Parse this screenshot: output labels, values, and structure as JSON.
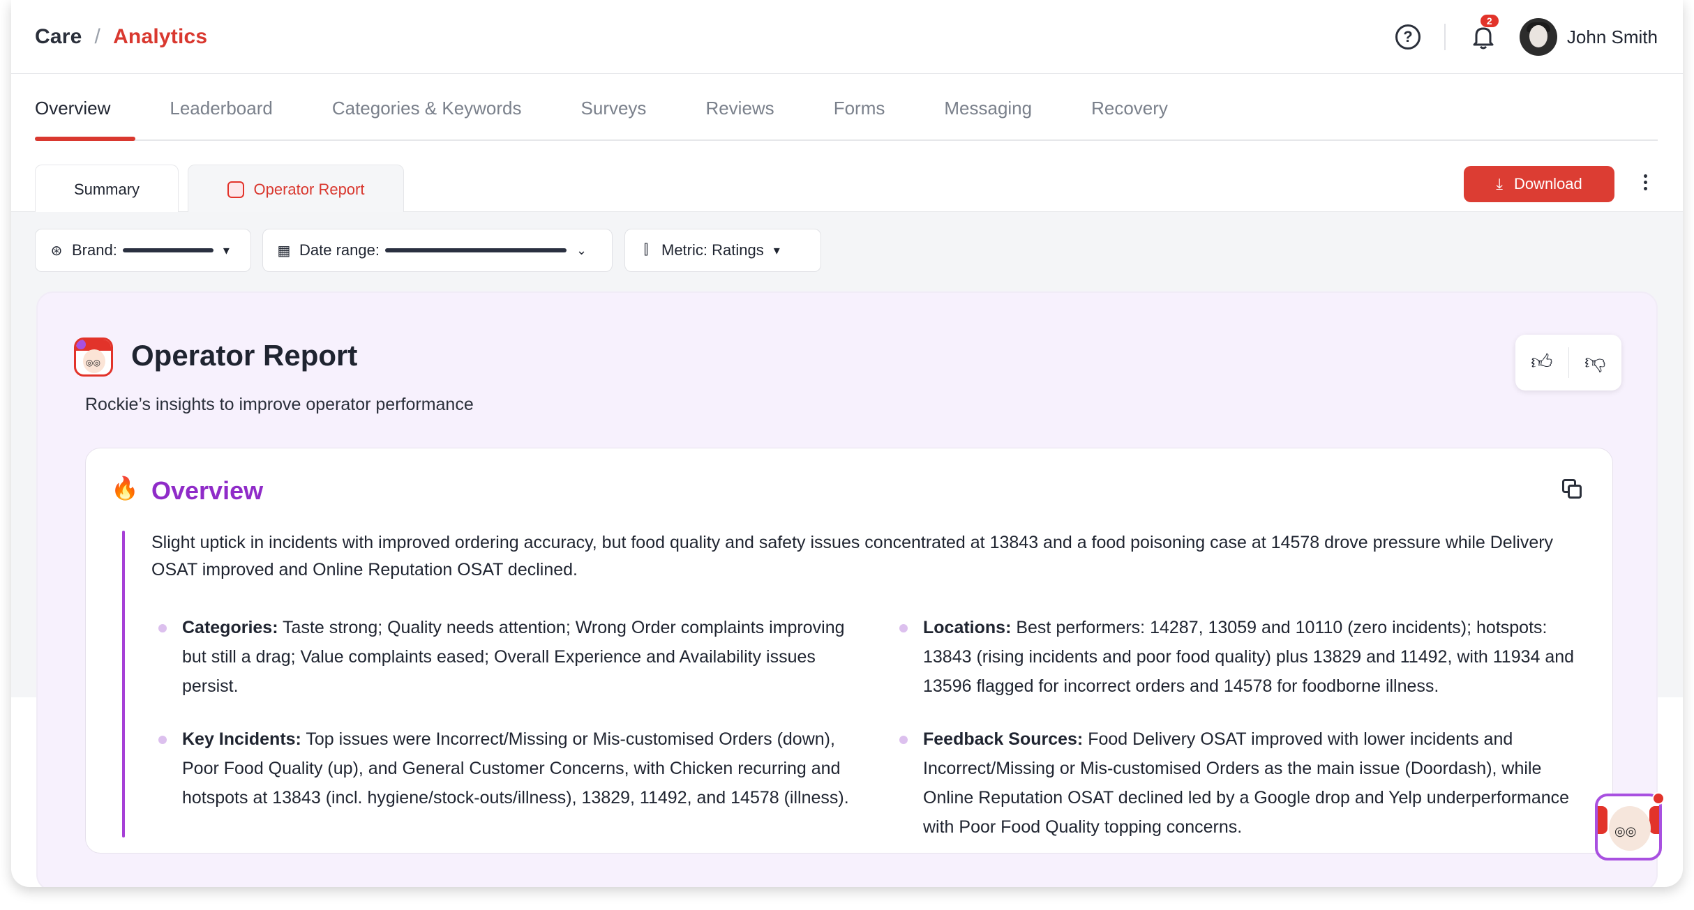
{
  "breadcrumb": {
    "parent": "Care",
    "separator": "/",
    "current": "Analytics"
  },
  "header": {
    "help_icon": "question-circle-icon",
    "notification_count": "2",
    "user_name": "John Smith"
  },
  "tabs": [
    {
      "label": "Overview",
      "active": true
    },
    {
      "label": "Leaderboard"
    },
    {
      "label": "Categories & Keywords"
    },
    {
      "label": "Surveys"
    },
    {
      "label": "Reviews"
    },
    {
      "label": "Forms"
    },
    {
      "label": "Messaging"
    },
    {
      "label": "Recovery"
    }
  ],
  "subtabs": {
    "summary": "Summary",
    "operator": "Operator Report"
  },
  "toolbar": {
    "download_label": "Download"
  },
  "filters": {
    "brand_label": "Brand:",
    "date_label": "Date range:",
    "metric_label": "Metric: Ratings"
  },
  "report": {
    "title": "Operator Report",
    "subtitle": "Rockie’s insights to improve operator performance",
    "overview_title": "Overview",
    "summary": "Slight uptick in incidents with improved ordering accuracy, but food quality and safety issues concentrated at 13843 and a food poisoning case at 14578 drove pressure while Delivery OSAT improved and Online Reputation OSAT declined.",
    "bullets": {
      "categories_label": "Categories:",
      "categories_text": " Taste strong; Quality needs attention; Wrong Order complaints improving but still a drag; Value complaints eased; Overall Experience and Availability issues persist.",
      "incidents_label": "Key Incidents:",
      "incidents_text": " Top issues were Incorrect/Missing or Mis-customised Orders (down), Poor Food Quality (up), and General Customer Concerns, with Chicken recurring and hotspots at 13843 (incl. hygiene/stock-outs/illness), 13829, 11492, and 14578 (illness).",
      "locations_label": "Locations:",
      "locations_text": " Best performers: 14287, 13059 and 10110 (zero incidents); hotspots: 13843 (rising incidents and poor food quality) plus 13829 and 11492, with 11934 and 13596 flagged for incorrect orders and 14578 for foodborne illness.",
      "feedback_label": "Feedback Sources:",
      "feedback_text": " Food Delivery OSAT improved with lower incidents and Incorrect/Missing or Mis-customised Orders as the main issue (Doordash), while Online Reputation OSAT declined led by a Google drop and Yelp underperformance with Poor Food Quality topping concerns."
    }
  },
  "colors": {
    "accent": "#d9382f",
    "purple": "#8f2bc8",
    "report_bg": "#f7f1fd"
  }
}
